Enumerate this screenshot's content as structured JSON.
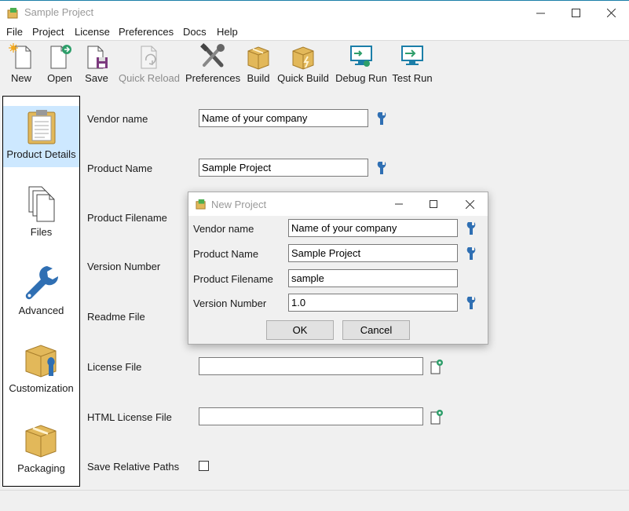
{
  "window": {
    "title": "Sample Project"
  },
  "menu": [
    "File",
    "Project",
    "License",
    "Preferences",
    "Docs",
    "Help"
  ],
  "toolbar": {
    "new": "New",
    "open": "Open",
    "save": "Save",
    "quick_reload": "Quick Reload",
    "preferences": "Preferences",
    "build": "Build",
    "quick_build": "Quick Build",
    "debug_run": "Debug Run",
    "test_run": "Test Run"
  },
  "sidebar": {
    "items": [
      {
        "label": "Product Details",
        "icon": "clipboard-icon",
        "active": true
      },
      {
        "label": "Files",
        "icon": "files-icon"
      },
      {
        "label": "Advanced",
        "icon": "wrench-icon"
      },
      {
        "label": "Customization",
        "icon": "box-wrench-icon"
      },
      {
        "label": "Packaging",
        "icon": "box-icon"
      }
    ]
  },
  "form": {
    "vendor_name_label": "Vendor name",
    "vendor_name_value": "Name of your company",
    "product_name_label": "Product Name",
    "product_name_value": "Sample Project",
    "product_filename_label": "Product Filename",
    "version_number_label": "Version Number",
    "readme_file_label": "Readme File",
    "license_file_label": "License File",
    "license_file_value": "",
    "html_license_file_label": "HTML License File",
    "html_license_file_value": "",
    "save_relative_paths_label": "Save Relative Paths"
  },
  "dialog": {
    "title": "New Project",
    "vendor_name_label": "Vendor name",
    "vendor_name_value": "Name of your company",
    "product_name_label": "Product Name",
    "product_name_value": "Sample Project",
    "product_filename_label": "Product Filename",
    "product_filename_value": "sample",
    "version_number_label": "Version Number",
    "version_number_value": "1.0",
    "ok": "OK",
    "cancel": "Cancel"
  },
  "colors": {
    "accent": "#1b7ea8",
    "selected": "#cde8ff",
    "wrench": "#2f6fb3",
    "box": "#e2b85a"
  }
}
